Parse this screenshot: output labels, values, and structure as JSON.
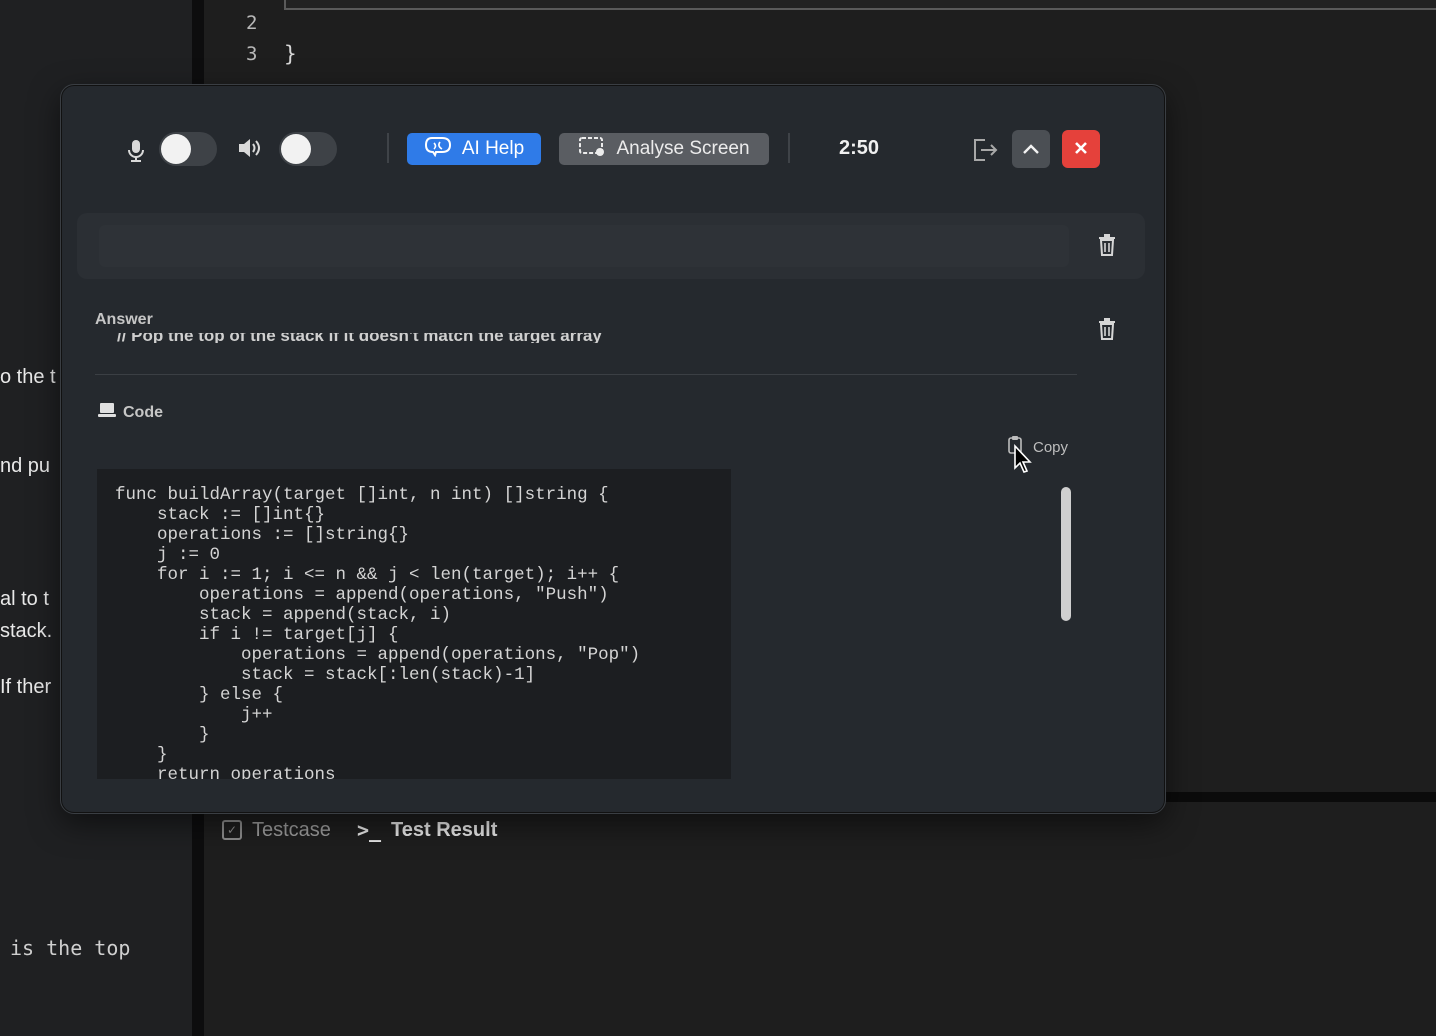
{
  "background": {
    "line_numbers": [
      "2",
      "3"
    ],
    "closing_brace": "}",
    "left_panel_fragments": [
      "o the t",
      "nd pu",
      "al to t",
      "stack.",
      " If ther"
    ],
    "bottom_mono_text": "is the top",
    "bottom_tabs": [
      {
        "label": "Testcase",
        "icon": "checkbox-icon"
      },
      {
        "label": "Test Result",
        "icon": "terminal-icon",
        "prefix": ">_"
      }
    ]
  },
  "toolbar": {
    "mic_toggle_on": false,
    "speaker_toggle_on": false,
    "ai_help_label": "AI Help",
    "analyse_label": "Analyse Screen",
    "timer": "2:50",
    "accent_color": "#2f7be8",
    "close_color": "#e5413b"
  },
  "answer": {
    "label": "Answer",
    "truncated_line": "// Pop the top of the stack if it doesn't match the target array",
    "code_label": "Code",
    "copy_label": "Copy",
    "code": "func buildArray(target []int, n int) []string {\n    stack := []int{}\n    operations := []string{}\n    j := 0\n    for i := 1; i <= n && j < len(target); i++ {\n        operations = append(operations, \"Push\")\n        stack = append(stack, i)\n        if i != target[j] {\n            operations = append(operations, \"Pop\")\n            stack = stack[:len(stack)-1]\n        } else {\n            j++\n        }\n    }\n    return operations"
  }
}
